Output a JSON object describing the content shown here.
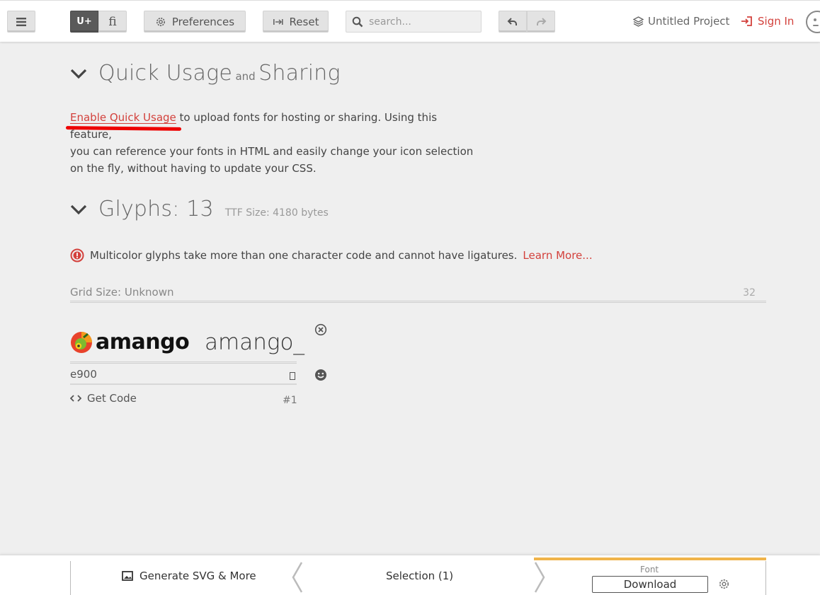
{
  "toolbar": {
    "unicode_label": "U+",
    "ligature_label": "fi",
    "preferences_label": "Preferences",
    "reset_label": "Reset",
    "search_placeholder": "search...",
    "project_title": "Untitled Project",
    "signin_label": "Sign In"
  },
  "quick_usage": {
    "title_part1": "Quick Usage",
    "title_and": "and",
    "title_part2": "Sharing",
    "link_text": "Enable Quick Usage",
    "body_line1": " to upload fonts for hosting or sharing. Using this feature,",
    "body_line2": "you can reference your fonts in HTML and easily change your icon selection",
    "body_line3": "on the fly, without having to update your CSS."
  },
  "glyphs": {
    "title": "Glyphs: 13",
    "ttf_size": "TTF Size: 4180 bytes",
    "notice_text": "Multicolor glyphs take more than one character code and cannot have ligatures.",
    "learn_more": "Learn More...",
    "grid_size": "Grid Size: Unknown",
    "grid_number": "32",
    "items": [
      {
        "logo_text": "amango",
        "name": "amango_",
        "code": "e900",
        "get_code_label": "Get Code",
        "index": "#1"
      }
    ]
  },
  "bottom": {
    "generate_label": "Generate SVG & More",
    "selection_label": "Selection (1)",
    "font_label": "Font",
    "download_label": "Download"
  },
  "colors": {
    "accent_red": "#d3413c",
    "font_tab_highlight": "#f0b44a"
  }
}
